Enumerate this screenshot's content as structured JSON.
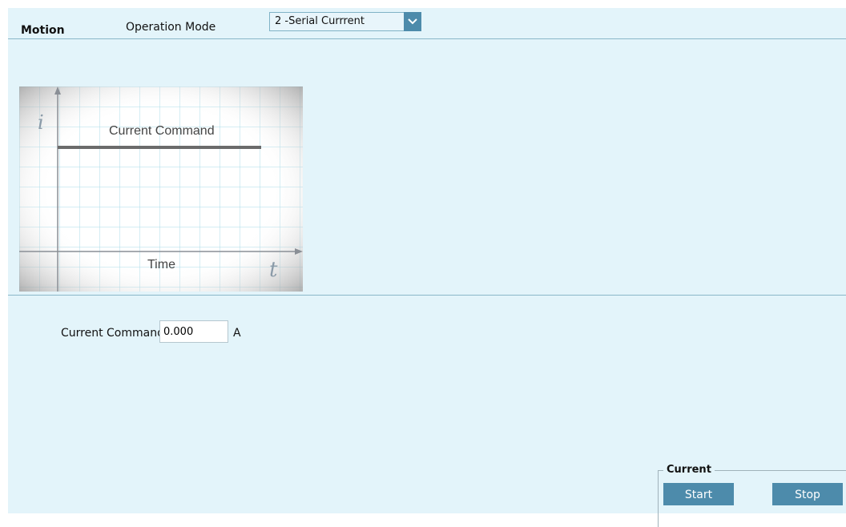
{
  "header": {
    "section_title": "Motion",
    "operation_mode_label": "Operation Mode",
    "operation_mode_value": "2 -Serial Currrent"
  },
  "illustration": {
    "y_axis_symbol": "i",
    "x_axis_symbol": "t",
    "line_label": "Current Command",
    "x_label": "Time"
  },
  "current_command": {
    "label": "Current Command",
    "value": "0.000",
    "unit": "A"
  },
  "current_group": {
    "title": "Current",
    "start_label": "Start",
    "stop_label": "Stop"
  }
}
